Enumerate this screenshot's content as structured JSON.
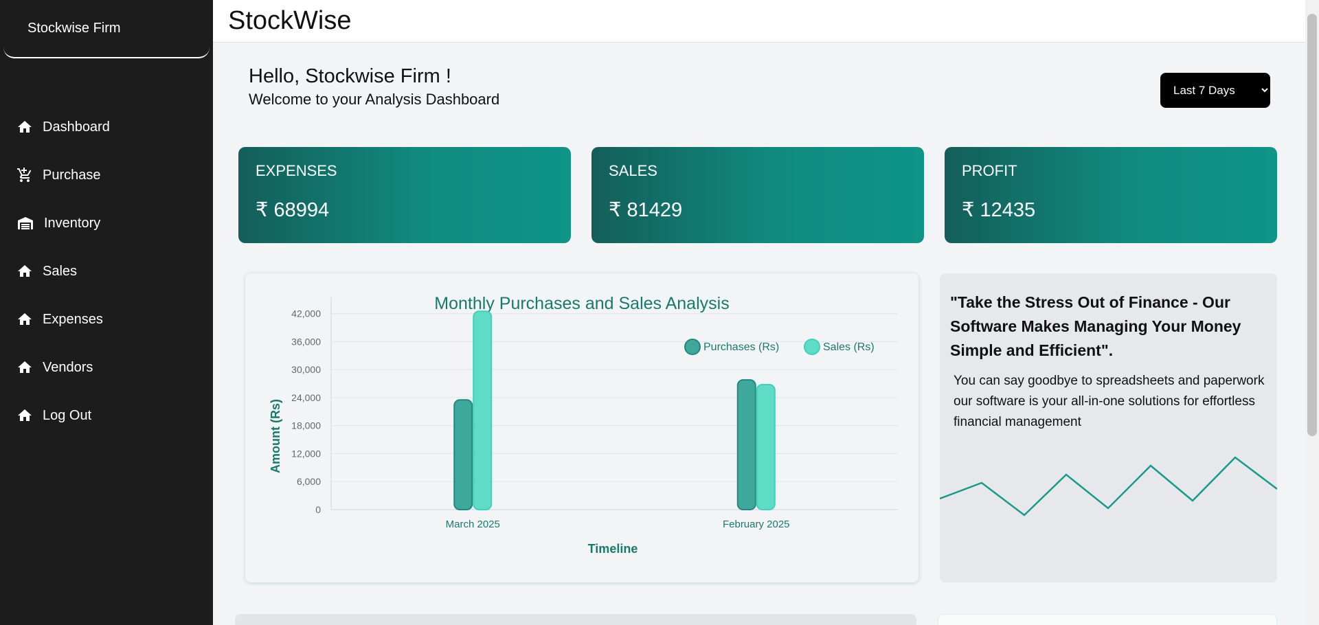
{
  "sidebar": {
    "brand": "Stockwise Firm",
    "items": [
      {
        "label": "Dashboard",
        "icon": "home-icon"
      },
      {
        "label": "Purchase",
        "icon": "cart-icon"
      },
      {
        "label": "Inventory",
        "icon": "warehouse-icon"
      },
      {
        "label": "Sales",
        "icon": "home-icon"
      },
      {
        "label": "Expenses",
        "icon": "home-icon"
      },
      {
        "label": "Vendors",
        "icon": "home-icon"
      },
      {
        "label": "Log Out",
        "icon": "home-icon"
      }
    ]
  },
  "header": {
    "title": "StockWise"
  },
  "greeting": {
    "title": "Hello, Stockwise Firm !",
    "subtitle": "Welcome to your Analysis Dashboard"
  },
  "period_select": {
    "selected": "Last 7 Days"
  },
  "stats": [
    {
      "label": "EXPENSES",
      "value": "₹ 68994"
    },
    {
      "label": "SALES",
      "value": "₹ 81429"
    },
    {
      "label": "PROFIT",
      "value": "₹ 12435"
    }
  ],
  "chart_data": {
    "type": "bar",
    "title": "Monthly Purchases and Sales Analysis",
    "xlabel": "Timeline",
    "ylabel": "Amount (Rs)",
    "categories": [
      "March 2025",
      "February 2025"
    ],
    "series": [
      {
        "name": "Purchases (Rs)",
        "values": [
          23500,
          27800
        ],
        "color": "#3fa89c"
      },
      {
        "name": "Sales (Rs)",
        "values": [
          42500,
          26800
        ],
        "color": "#5fdcc6"
      }
    ],
    "ylim": [
      0,
      44000
    ],
    "yticks": [
      0,
      6000,
      12000,
      18000,
      24000,
      30000,
      36000,
      42000
    ],
    "ytick_labels": [
      "0",
      "6,000",
      "12,000",
      "18,000",
      "24,000",
      "30,000",
      "36,000",
      "42,000"
    ],
    "legend": "top-right",
    "grid": true
  },
  "quote": {
    "title": "\"Take the Stress Out of Finance - Our Software Makes Managing Your Money Simple and Efficient\".",
    "body": "You can say goodbye to spreadsheets and paperwork our software is your all-in-one solutions for effortless financial management"
  },
  "colors": {
    "sidebar_bg": "#1c1c1c",
    "accent": "#0f9488",
    "chart_text": "#167a6e"
  }
}
